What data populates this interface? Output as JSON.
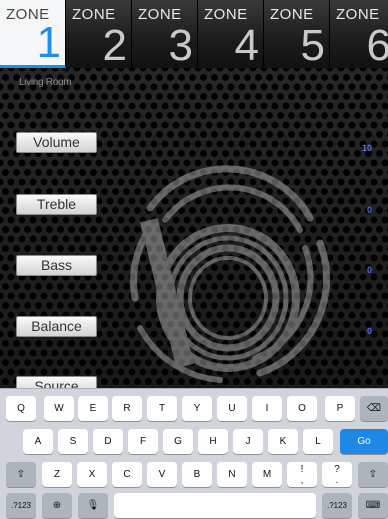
{
  "zones": [
    {
      "label": "ZONE",
      "number": "1",
      "active": true
    },
    {
      "label": "ZONE",
      "number": "2",
      "active": false
    },
    {
      "label": "ZONE",
      "number": "3",
      "active": false
    },
    {
      "label": "ZONE",
      "number": "4",
      "active": false
    },
    {
      "label": "ZONE",
      "number": "5",
      "active": false
    },
    {
      "label": "ZONE",
      "number": "6",
      "active": false
    }
  ],
  "room_name": "Living Room",
  "controls": [
    {
      "label": "Volume",
      "value": "10"
    },
    {
      "label": "Treble",
      "value": "0"
    },
    {
      "label": "Bass",
      "value": "0"
    },
    {
      "label": "Balance",
      "value": "0"
    },
    {
      "label": "Source",
      "value": ""
    }
  ],
  "keyboard": {
    "row1": [
      "Q",
      "W",
      "E",
      "R",
      "T",
      "Y",
      "U",
      "I",
      "O",
      "P"
    ],
    "row2": [
      "A",
      "S",
      "D",
      "F",
      "G",
      "H",
      "J",
      "K",
      "L"
    ],
    "row3": [
      "Z",
      "X",
      "C",
      "V",
      "B",
      "N",
      "M",
      "!\n,",
      "?\n."
    ],
    "go_label": "Go",
    "numbers_label": ".?123"
  },
  "colors": {
    "accent": "#1f8fe8",
    "value_text": "#5a6fd8"
  }
}
